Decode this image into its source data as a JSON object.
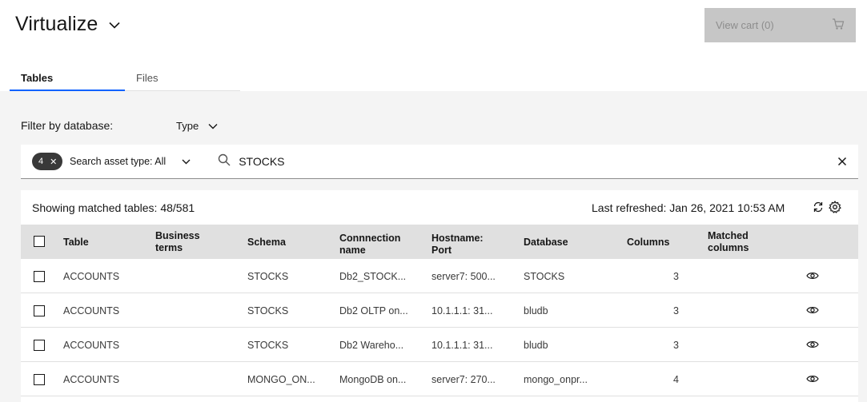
{
  "header": {
    "title": "Virtualize",
    "cart_label": "View cart (0)"
  },
  "tabs": [
    {
      "label": "Tables",
      "active": true
    },
    {
      "label": "Files",
      "active": false
    }
  ],
  "filter": {
    "label": "Filter by database:",
    "type_label": "Type"
  },
  "search": {
    "tag_count": "4",
    "asset_type_label": "Search asset type: All",
    "query": "STOCKS"
  },
  "results": {
    "showing": "Showing matched tables: 48/581",
    "last_refreshed": "Last refreshed: Jan 26, 2021 10:53 AM"
  },
  "table": {
    "columns": {
      "table": "Table",
      "business_terms": "Business terms",
      "schema": "Schema",
      "connection_name": "Connnection name",
      "hostname_port": "Hostname: Port",
      "database": "Database",
      "columns": "Columns",
      "matched_columns": "Matched columns"
    },
    "rows": [
      {
        "table": "ACCOUNTS",
        "business_terms": "",
        "schema": "STOCKS",
        "connection": "Db2_STOCK...",
        "host": "server7: 500...",
        "database": "STOCKS",
        "columns": "3",
        "matched": ""
      },
      {
        "table": "ACCOUNTS",
        "business_terms": "",
        "schema": "STOCKS",
        "connection": "Db2 OLTP on...",
        "host": "10.1.1.1: 31...",
        "database": "bludb",
        "columns": "3",
        "matched": ""
      },
      {
        "table": "ACCOUNTS",
        "business_terms": "",
        "schema": "STOCKS",
        "connection": "Db2 Wareho...",
        "host": "10.1.1.1: 31...",
        "database": "bludb",
        "columns": "3",
        "matched": ""
      },
      {
        "table": "ACCOUNTS",
        "business_terms": "",
        "schema": "MONGO_ON...",
        "connection": "MongoDB on...",
        "host": "server7: 270...",
        "database": "mongo_onpr...",
        "columns": "4",
        "matched": ""
      }
    ]
  },
  "colors": {
    "accent": "#0f62fe",
    "disabled_button": "#c6c6c6",
    "table_header": "#e0e0e0",
    "page_background": "#f4f4f4"
  },
  "icons": [
    "chevron-down-icon",
    "cart-icon",
    "close-icon",
    "search-icon",
    "refresh-icon",
    "settings-icon",
    "eye-icon"
  ]
}
